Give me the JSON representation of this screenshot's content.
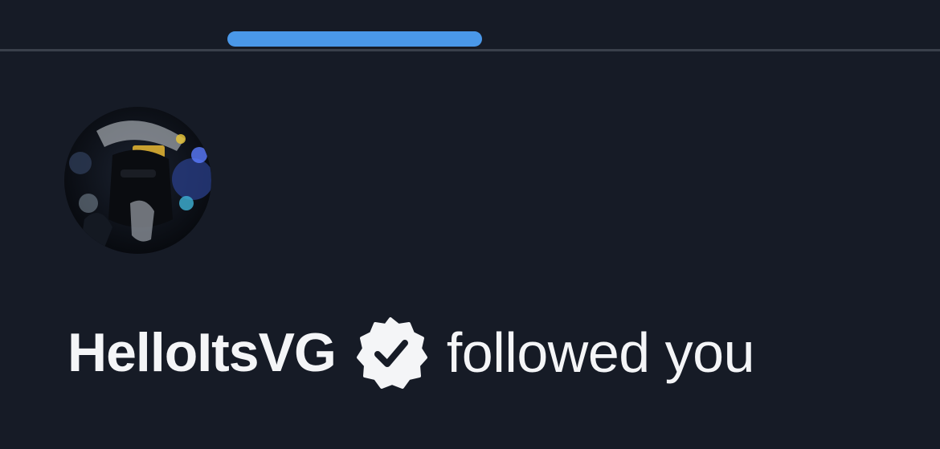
{
  "tabs": {
    "active_indicator_color": "#4a98e9"
  },
  "notification": {
    "username": "HelloItsVG",
    "verified_icon": "verified-badge-icon",
    "action_text": "followed you"
  },
  "colors": {
    "background": "#161b26",
    "divider": "#3a404b",
    "text": "#f4f5f7"
  }
}
